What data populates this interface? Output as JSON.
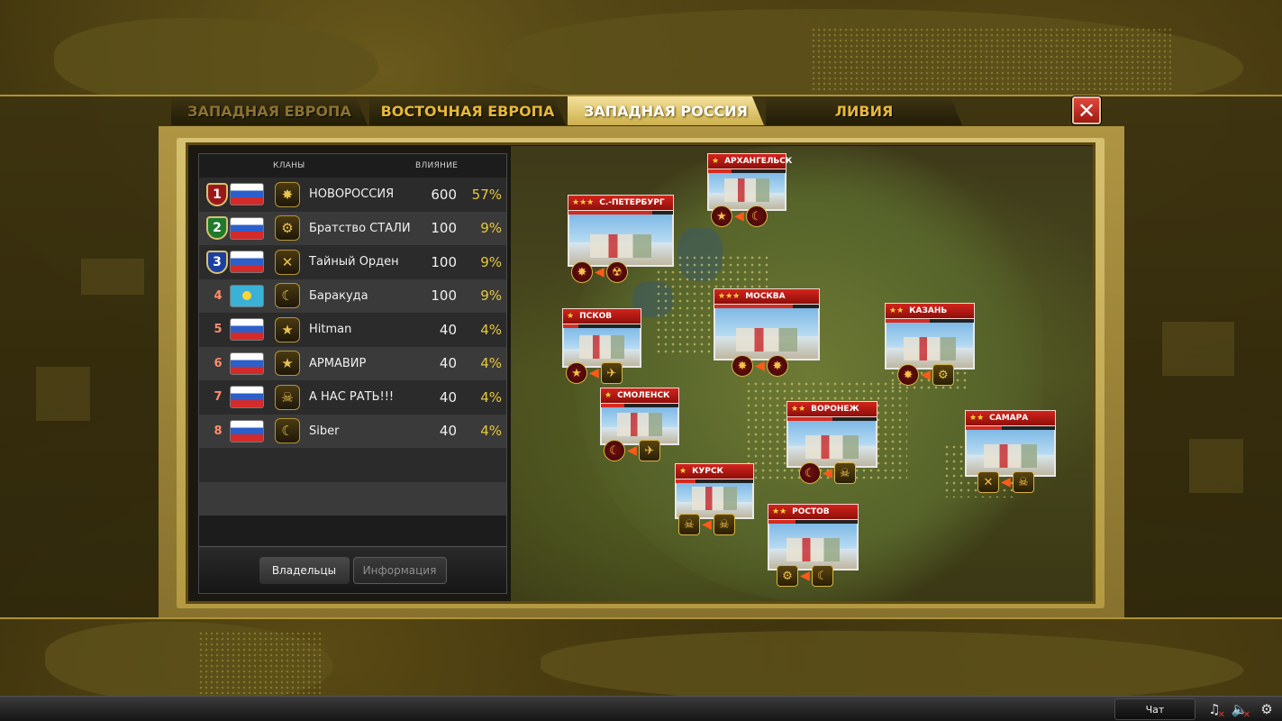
{
  "tabs": [
    {
      "label": "ЗАПАДНАЯ ЕВРОПА",
      "state": "dim"
    },
    {
      "label": "ВОСТОЧНАЯ ЕВРОПА",
      "state": "normal"
    },
    {
      "label": "ЗАПАДНАЯ РОССИЯ",
      "state": "active"
    },
    {
      "label": "ЛИВИЯ",
      "state": "normal"
    }
  ],
  "close_icon": "close-icon",
  "clan_table": {
    "header_clans": "КЛАНЫ",
    "header_influence": "ВЛИЯНИЕ",
    "rows": [
      {
        "rank": "1",
        "flag": "ru",
        "emblem": "✸",
        "name": "НОВОРОССИЯ",
        "influence": "600",
        "percent": "57%"
      },
      {
        "rank": "2",
        "flag": "ru",
        "emblem": "⚙",
        "name": "Братство СТАЛИ",
        "influence": "100",
        "percent": "9%"
      },
      {
        "rank": "3",
        "flag": "ru",
        "emblem": "✕",
        "name": "Тайный Орден",
        "influence": "100",
        "percent": "9%"
      },
      {
        "rank": "4",
        "flag": "kz",
        "emblem": "☾",
        "name": "Баракуда",
        "influence": "100",
        "percent": "9%"
      },
      {
        "rank": "5",
        "flag": "ru",
        "emblem": "★",
        "name": "Hitman",
        "influence": "40",
        "percent": "4%"
      },
      {
        "rank": "6",
        "flag": "ru",
        "emblem": "★",
        "name": "АРМАВИР",
        "influence": "40",
        "percent": "4%"
      },
      {
        "rank": "7",
        "flag": "ru",
        "emblem": "☠",
        "name": "А НАС РАТЬ!!!",
        "influence": "40",
        "percent": "4%"
      },
      {
        "rank": "8",
        "flag": "ru",
        "emblem": "☾",
        "name": "Siber",
        "influence": "40",
        "percent": "4%"
      }
    ],
    "btn_owners": "Владельцы",
    "btn_info": "Информация"
  },
  "cities": [
    {
      "name": "С.-ПЕТЕРБУРГ",
      "stars": "★★★",
      "control": 0.8,
      "icons": [
        "✸",
        "☢"
      ]
    },
    {
      "name": "АРХАНГЕЛЬСК",
      "stars": "★",
      "control": 0.3,
      "icons": [
        "★",
        "☾"
      ]
    },
    {
      "name": "МОСКВА",
      "stars": "★★★",
      "control": 0.75,
      "icons": [
        "✸",
        "✸"
      ]
    },
    {
      "name": "ПСКОВ",
      "stars": "★",
      "control": 0.2,
      "icons": [
        "★",
        "✈"
      ]
    },
    {
      "name": "КАЗАНЬ",
      "stars": "★★",
      "control": 0.5,
      "icons": [
        "✸",
        "⚙"
      ]
    },
    {
      "name": "СМОЛЕНСК",
      "stars": "★",
      "control": 0.3,
      "icons": [
        "☾",
        "✈"
      ]
    },
    {
      "name": "ВОРОНЕЖ",
      "stars": "★★",
      "control": 0.5,
      "icons": [
        "☾",
        "☠"
      ]
    },
    {
      "name": "САМАРА",
      "stars": "★★",
      "control": 0.4,
      "icons": [
        "✕",
        "☠"
      ]
    },
    {
      "name": "КУРСК",
      "stars": "★",
      "control": 0.25,
      "icons": [
        "☠",
        "☠"
      ]
    },
    {
      "name": "РОСТОВ",
      "stars": "★★",
      "control": 0.3,
      "icons": [
        "⚙",
        "☾"
      ]
    }
  ],
  "bottom_bar": {
    "chat_label": "Чат",
    "icons": [
      "music-muted-icon",
      "sound-muted-icon",
      "settings-icon"
    ]
  }
}
